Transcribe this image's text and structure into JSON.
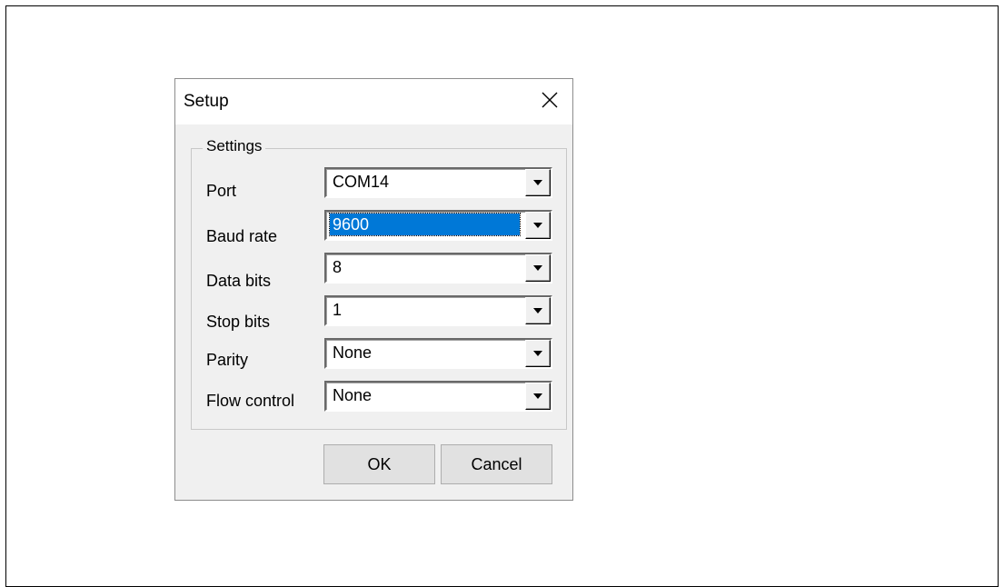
{
  "dialog": {
    "title": "Setup",
    "group_label": "Settings",
    "rows": [
      {
        "label": "Port",
        "value": "COM14"
      },
      {
        "label": "Baud rate",
        "value": "9600"
      },
      {
        "label": "Data bits",
        "value": "8"
      },
      {
        "label": "Stop bits",
        "value": "1"
      },
      {
        "label": "Parity",
        "value": "None"
      },
      {
        "label": "Flow control",
        "value": "None"
      }
    ],
    "ok_label": "OK",
    "cancel_label": "Cancel"
  },
  "colors": {
    "selection": "#0078d7",
    "dialog_bg": "#f0f0f0"
  },
  "icons": [
    "close-icon",
    "chevron-down-icon"
  ]
}
